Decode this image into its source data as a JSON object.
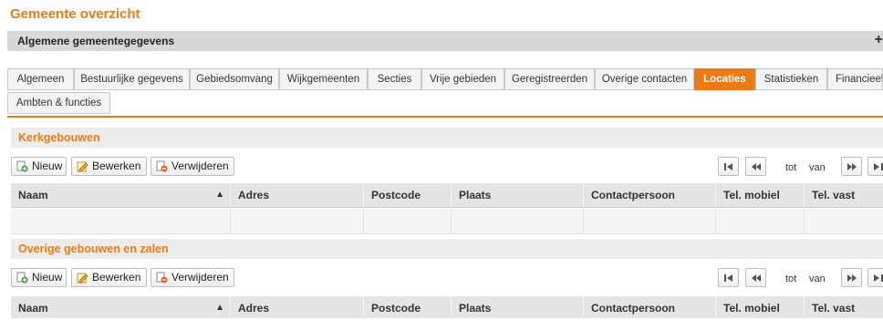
{
  "page": {
    "title": "Gemeente overzicht"
  },
  "general": {
    "label": "Algemene gemeentegegevens",
    "toggle": "+"
  },
  "tabs": [
    {
      "label": "Algemeen",
      "active": false
    },
    {
      "label": "Bestuurlijke gegevens",
      "active": false
    },
    {
      "label": "Gebiedsomvang",
      "active": false
    },
    {
      "label": "Wijkgemeenten",
      "active": false
    },
    {
      "label": "Secties",
      "active": false
    },
    {
      "label": "Vrije gebieden",
      "active": false
    },
    {
      "label": "Geregistreerden",
      "active": false
    },
    {
      "label": "Overige contacten",
      "active": false
    },
    {
      "label": "Locaties",
      "active": true
    },
    {
      "label": "Statistieken",
      "active": false
    },
    {
      "label": "Financieel",
      "active": false
    },
    {
      "label": "Ambten & functies",
      "active": false
    }
  ],
  "toolbar": {
    "new": "Nieuw",
    "edit": "Bewerken",
    "delete": "Verwijderen"
  },
  "pager": {
    "to": "tot",
    "of": "van"
  },
  "columns": [
    "Naam",
    "Adres",
    "Postcode",
    "Plaats",
    "Contactpersoon",
    "Tel. mobiel",
    "Tel. vast"
  ],
  "sort_indicator": "▲",
  "sections": [
    {
      "title": "Kerkgebouwen"
    },
    {
      "title": "Overige gebouwen en zalen"
    }
  ],
  "colors": {
    "accent": "#ee7a14",
    "header_bg": "#e4e4e4",
    "bar_bg": "#d8d8d8"
  }
}
